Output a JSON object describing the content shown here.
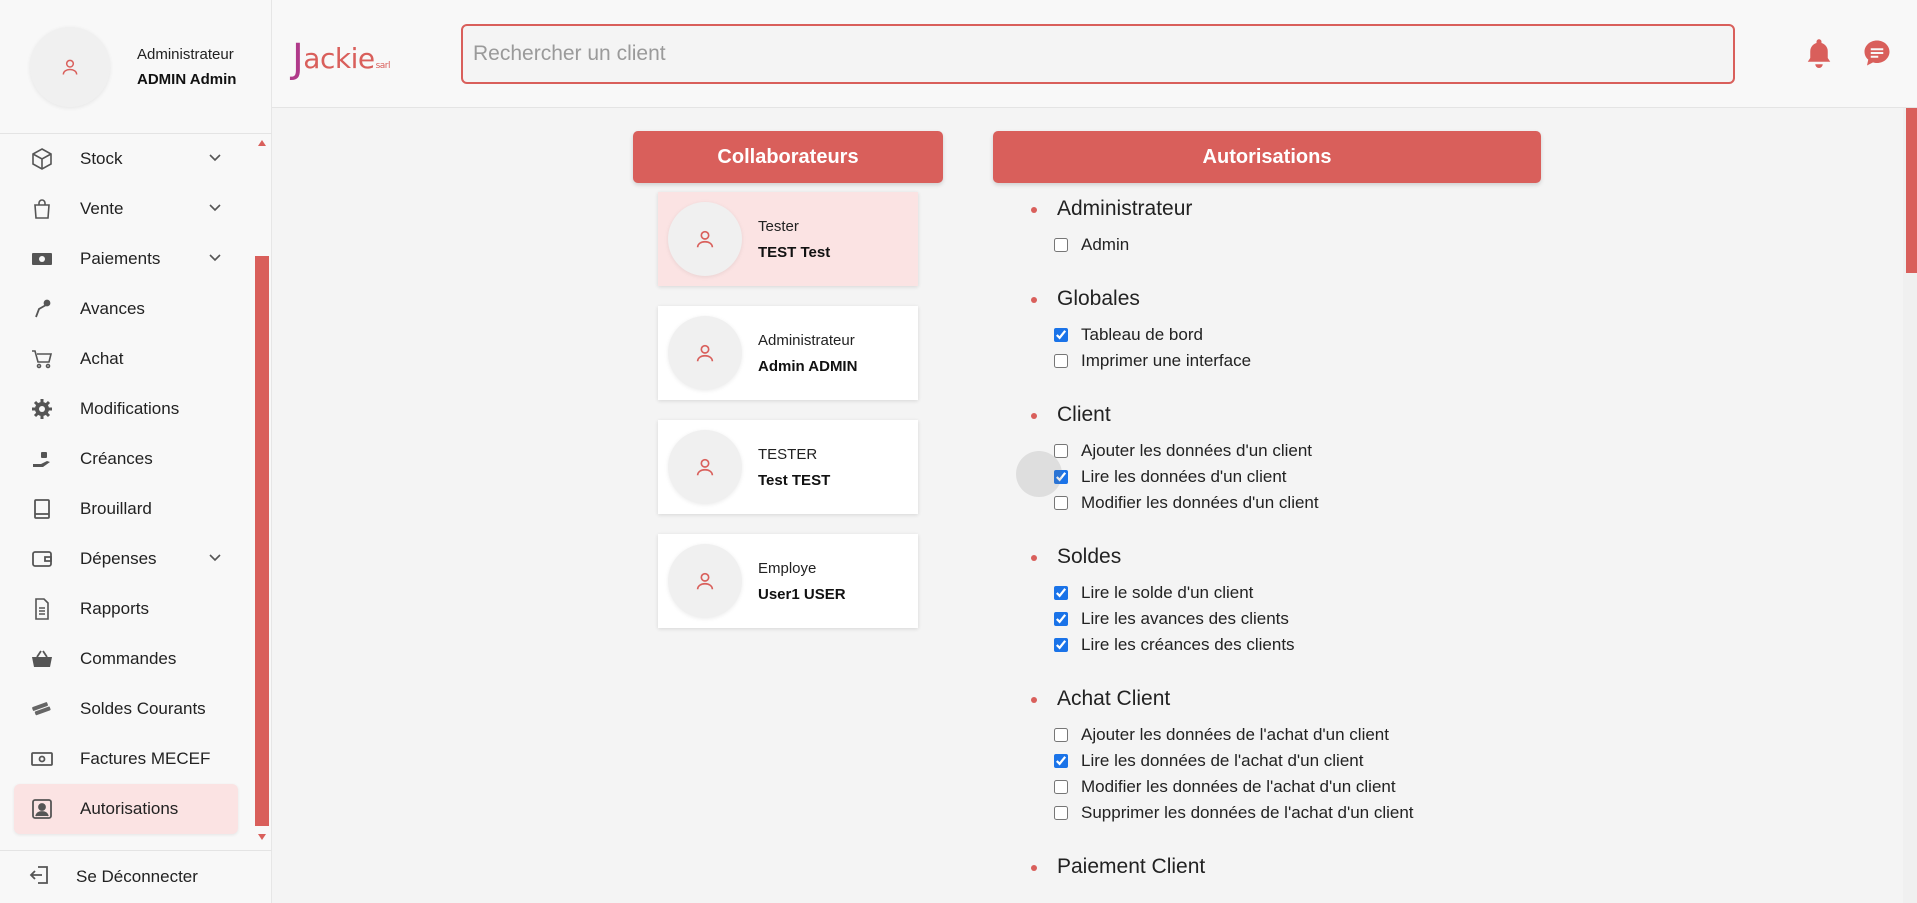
{
  "sidebar": {
    "profile": {
      "role": "Administrateur",
      "name": "ADMIN Admin",
      "avatar_icon": "user-icon"
    },
    "items": [
      {
        "label": "Stock",
        "icon": "box-icon",
        "has_submenu": true
      },
      {
        "label": "Vente",
        "icon": "shopping-bag-icon",
        "has_submenu": true
      },
      {
        "label": "Paiements",
        "icon": "banknote-icon",
        "has_submenu": true
      },
      {
        "label": "Avances",
        "icon": "hand-coin-icon",
        "has_submenu": false
      },
      {
        "label": "Achat",
        "icon": "cart-icon",
        "has_submenu": false
      },
      {
        "label": "Modifications",
        "icon": "gear-icon",
        "has_submenu": false
      },
      {
        "label": "Créances",
        "icon": "hand-money-icon",
        "has_submenu": false
      },
      {
        "label": "Brouillard",
        "icon": "book-icon",
        "has_submenu": false
      },
      {
        "label": "Dépenses",
        "icon": "wallet-icon",
        "has_submenu": true
      },
      {
        "label": "Rapports",
        "icon": "document-icon",
        "has_submenu": false
      },
      {
        "label": "Commandes",
        "icon": "basket-icon",
        "has_submenu": false
      },
      {
        "label": "Soldes Courants",
        "icon": "money-stack-icon",
        "has_submenu": false
      },
      {
        "label": "Factures MECEF",
        "icon": "banknote-icon",
        "has_submenu": false
      },
      {
        "label": "Autorisations",
        "icon": "user-badge-icon",
        "has_submenu": false,
        "active": true
      }
    ],
    "logout_label": "Se Déconnecter"
  },
  "header": {
    "logo_initial": "J",
    "logo_rest": "ackie",
    "logo_suffix": "sarl",
    "search_placeholder": "Rechercher un client"
  },
  "collaborateurs": {
    "title": "Collaborateurs",
    "cards": [
      {
        "role": "Tester",
        "name": "TEST Test",
        "selected": true
      },
      {
        "role": "Administrateur",
        "name": "Admin ADMIN",
        "selected": false
      },
      {
        "role": "TESTER",
        "name": "Test TEST",
        "selected": false
      },
      {
        "role": "Employe",
        "name": "User1 USER",
        "selected": false
      }
    ]
  },
  "autorisations": {
    "title": "Autorisations",
    "groups": [
      {
        "title": "Administrateur",
        "perms": [
          {
            "label": "Admin",
            "checked": false
          }
        ]
      },
      {
        "title": "Globales",
        "perms": [
          {
            "label": "Tableau de bord",
            "checked": true
          },
          {
            "label": "Imprimer une interface",
            "checked": false
          }
        ]
      },
      {
        "title": "Client",
        "perms": [
          {
            "label": "Ajouter les données d'un client",
            "checked": false
          },
          {
            "label": "Lire les données d'un client",
            "checked": true
          },
          {
            "label": "Modifier les données d'un client",
            "checked": false
          }
        ]
      },
      {
        "title": "Soldes",
        "perms": [
          {
            "label": "Lire le solde d'un client",
            "checked": true
          },
          {
            "label": "Lire les avances des clients",
            "checked": true
          },
          {
            "label": "Lire les créances des clients",
            "checked": true
          }
        ]
      },
      {
        "title": "Achat Client",
        "perms": [
          {
            "label": "Ajouter les données de l'achat d'un client",
            "checked": false
          },
          {
            "label": "Lire les données de l'achat d'un client",
            "checked": true
          },
          {
            "label": "Modifier les données de l'achat d'un client",
            "checked": false
          },
          {
            "label": "Supprimer les données de l'achat d'un client",
            "checked": false
          }
        ]
      },
      {
        "title": "Paiement Client",
        "perms": []
      }
    ]
  },
  "colors": {
    "accent": "#d95f5b",
    "selected_bg": "#fbe3e3",
    "logo_j": "#b03a8a"
  }
}
